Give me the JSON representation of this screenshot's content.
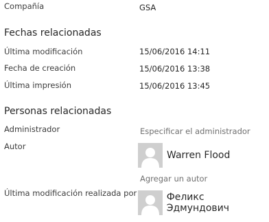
{
  "company": {
    "label": "Compañía",
    "value": "GSA"
  },
  "related_dates": {
    "heading": "Fechas relacionadas",
    "rows": [
      {
        "label": "Última modificación",
        "value": "15/06/2016 14:11"
      },
      {
        "label": "Fecha de creación",
        "value": "15/06/2016 13:38"
      },
      {
        "label": "Última impresión",
        "value": "15/06/2016 13:45"
      }
    ]
  },
  "related_people": {
    "heading": "Personas relacionadas",
    "manager": {
      "label": "Administrador",
      "link": "Especificar el administrador"
    },
    "author": {
      "label": "Autor",
      "name": "Warren Flood",
      "add_link": "Agregar un autor"
    },
    "last_modified_by": {
      "label": "Última modificación realizada por",
      "name": "Феликс Эдмундович"
    }
  }
}
